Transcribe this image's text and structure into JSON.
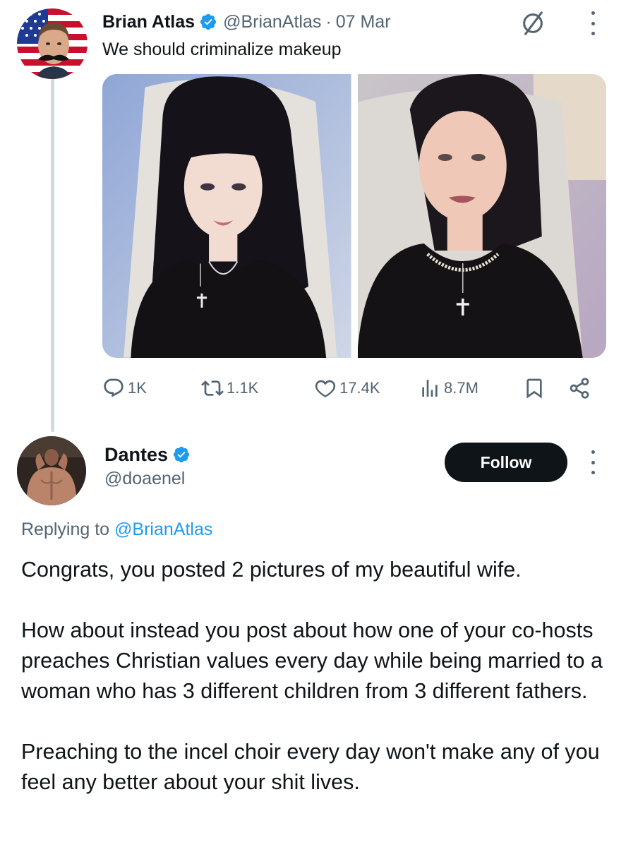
{
  "parent_tweet": {
    "author_name": "Brian Atlas",
    "handle": "@BrianAtlas",
    "separator": "·",
    "date": "07 Mar",
    "text": "We should criminalize makeup",
    "media_count": 2,
    "stats": {
      "replies": "1K",
      "retweets": "1.1K",
      "likes": "17.4K",
      "views": "8.7M"
    }
  },
  "reply": {
    "author_name": "Dantes",
    "handle": "@doaenel",
    "follow_label": "Follow",
    "replying_prefix": "Replying to ",
    "replying_handle": "@BrianAtlas",
    "paragraphs": [
      "Congrats, you posted 2 pictures of my beautiful wife.",
      "How about instead you post about how one of your co-hosts preaches Christian values every day while being married to a woman who has 3 different children from 3 different fathers.",
      "Preaching to the incel choir every day won't make any of you feel any better about your shit lives."
    ]
  },
  "colors": {
    "text": "#0f1419",
    "secondary": "#536471",
    "accent": "#1d9bf0",
    "follow_button": "#0f1419"
  }
}
